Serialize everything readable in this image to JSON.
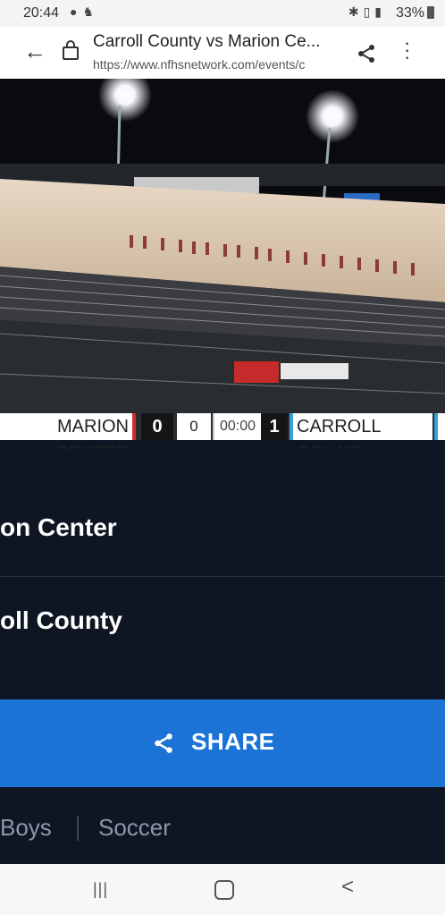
{
  "status_bar": {
    "time": "20:44",
    "battery": "33%",
    "icons": [
      "chat-bubble-icon",
      "mouse-icon",
      "bluetooth-icon",
      "vibrate-icon",
      "signal-icon",
      "battery-icon"
    ]
  },
  "browser": {
    "page_title": "Carroll County vs Marion Ce...",
    "url": "https://www.nfhsnetwork.com/events/c"
  },
  "scoreboard": {
    "home_team": "MARION CENTER",
    "home_score": "0",
    "period": "0",
    "clock": "00:00",
    "away_score": "1",
    "away_team": "CARROLL COUNTY"
  },
  "event": {
    "team1": "on Center",
    "team2": "oll County",
    "share_label": "SHARE",
    "tag1": "Boys",
    "tag2": "Soccer"
  },
  "colors": {
    "accent_blue": "#1b73d6",
    "panel_bg": "#0e1624",
    "home_stripe": "#d62828",
    "away_stripe": "#3aa0d8"
  }
}
